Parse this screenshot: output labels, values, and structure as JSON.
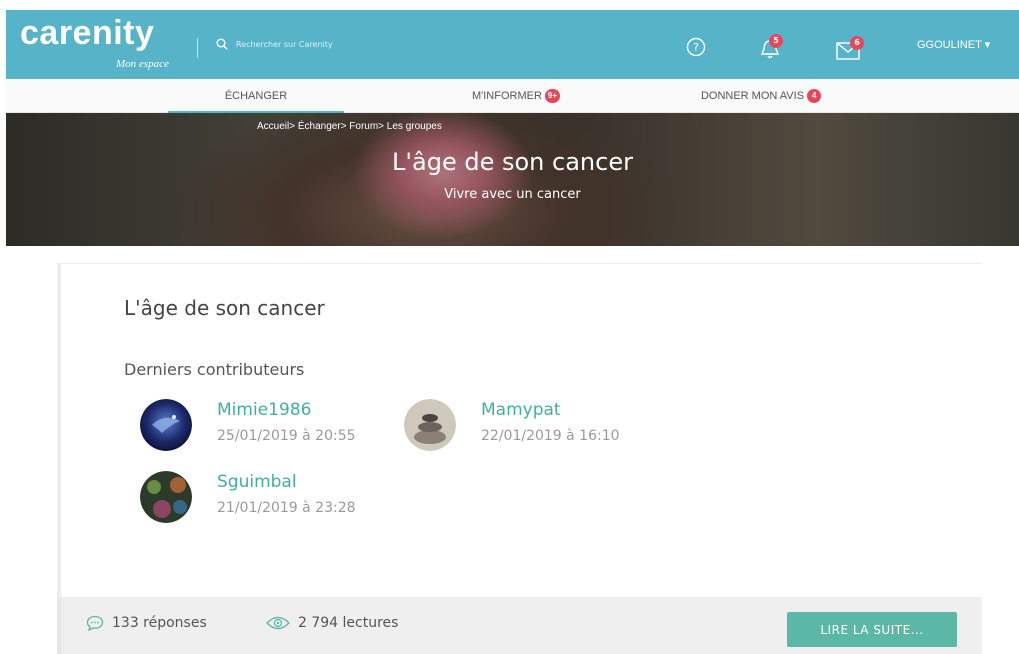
{
  "header": {
    "logo_text": "carenity",
    "logo_sub": "Mon espace",
    "search_placeholder": "Rechercher sur Carenity",
    "notifications_count": "5",
    "messages_count": "6",
    "user_label": "GGOULINET ▾"
  },
  "nav": {
    "tabs": [
      {
        "label": "ÉCHANGER",
        "count": ""
      },
      {
        "label": "M'INFORMER",
        "count": "9+"
      },
      {
        "label": "DONNER MON AVIS",
        "count": "4"
      }
    ]
  },
  "hero": {
    "breadcrumb": "Accueil> Échanger> Forum> Les groupes",
    "title": "L'âge de son cancer",
    "subtitle": "Vivre avec un cancer"
  },
  "card": {
    "title": "L'âge de son cancer",
    "contributors_heading": "Derniers contributeurs",
    "contributors": [
      {
        "name": "Mimie1986",
        "date": "25/01/2019 à 20:55"
      },
      {
        "name": "Mamypat",
        "date": "22/01/2019 à 16:10"
      },
      {
        "name": "Sguimbal",
        "date": "21/01/2019 à 23:28"
      }
    ]
  },
  "footer": {
    "replies": "133 réponses",
    "reads": "2 794 lectures",
    "read_more": "LIRE LA SUITE..."
  },
  "colors": {
    "brand": "#57b3c8",
    "accent": "#5cb8a6",
    "badge": "#e8475a"
  }
}
